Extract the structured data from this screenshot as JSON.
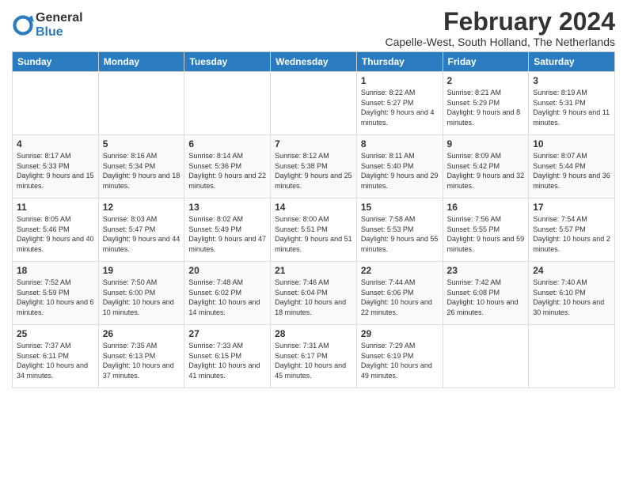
{
  "logo": {
    "general": "General",
    "blue": "Blue"
  },
  "header": {
    "title": "February 2024",
    "subtitle": "Capelle-West, South Holland, The Netherlands"
  },
  "weekdays": [
    "Sunday",
    "Monday",
    "Tuesday",
    "Wednesday",
    "Thursday",
    "Friday",
    "Saturday"
  ],
  "weeks": [
    [
      {
        "day": "",
        "info": ""
      },
      {
        "day": "",
        "info": ""
      },
      {
        "day": "",
        "info": ""
      },
      {
        "day": "",
        "info": ""
      },
      {
        "day": "1",
        "info": "Sunrise: 8:22 AM\nSunset: 5:27 PM\nDaylight: 9 hours\nand 4 minutes."
      },
      {
        "day": "2",
        "info": "Sunrise: 8:21 AM\nSunset: 5:29 PM\nDaylight: 9 hours\nand 8 minutes."
      },
      {
        "day": "3",
        "info": "Sunrise: 8:19 AM\nSunset: 5:31 PM\nDaylight: 9 hours\nand 11 minutes."
      }
    ],
    [
      {
        "day": "4",
        "info": "Sunrise: 8:17 AM\nSunset: 5:33 PM\nDaylight: 9 hours\nand 15 minutes."
      },
      {
        "day": "5",
        "info": "Sunrise: 8:16 AM\nSunset: 5:34 PM\nDaylight: 9 hours\nand 18 minutes."
      },
      {
        "day": "6",
        "info": "Sunrise: 8:14 AM\nSunset: 5:36 PM\nDaylight: 9 hours\nand 22 minutes."
      },
      {
        "day": "7",
        "info": "Sunrise: 8:12 AM\nSunset: 5:38 PM\nDaylight: 9 hours\nand 25 minutes."
      },
      {
        "day": "8",
        "info": "Sunrise: 8:11 AM\nSunset: 5:40 PM\nDaylight: 9 hours\nand 29 minutes."
      },
      {
        "day": "9",
        "info": "Sunrise: 8:09 AM\nSunset: 5:42 PM\nDaylight: 9 hours\nand 32 minutes."
      },
      {
        "day": "10",
        "info": "Sunrise: 8:07 AM\nSunset: 5:44 PM\nDaylight: 9 hours\nand 36 minutes."
      }
    ],
    [
      {
        "day": "11",
        "info": "Sunrise: 8:05 AM\nSunset: 5:46 PM\nDaylight: 9 hours\nand 40 minutes."
      },
      {
        "day": "12",
        "info": "Sunrise: 8:03 AM\nSunset: 5:47 PM\nDaylight: 9 hours\nand 44 minutes."
      },
      {
        "day": "13",
        "info": "Sunrise: 8:02 AM\nSunset: 5:49 PM\nDaylight: 9 hours\nand 47 minutes."
      },
      {
        "day": "14",
        "info": "Sunrise: 8:00 AM\nSunset: 5:51 PM\nDaylight: 9 hours\nand 51 minutes."
      },
      {
        "day": "15",
        "info": "Sunrise: 7:58 AM\nSunset: 5:53 PM\nDaylight: 9 hours\nand 55 minutes."
      },
      {
        "day": "16",
        "info": "Sunrise: 7:56 AM\nSunset: 5:55 PM\nDaylight: 9 hours\nand 59 minutes."
      },
      {
        "day": "17",
        "info": "Sunrise: 7:54 AM\nSunset: 5:57 PM\nDaylight: 10 hours\nand 2 minutes."
      }
    ],
    [
      {
        "day": "18",
        "info": "Sunrise: 7:52 AM\nSunset: 5:59 PM\nDaylight: 10 hours\nand 6 minutes."
      },
      {
        "day": "19",
        "info": "Sunrise: 7:50 AM\nSunset: 6:00 PM\nDaylight: 10 hours\nand 10 minutes."
      },
      {
        "day": "20",
        "info": "Sunrise: 7:48 AM\nSunset: 6:02 PM\nDaylight: 10 hours\nand 14 minutes."
      },
      {
        "day": "21",
        "info": "Sunrise: 7:46 AM\nSunset: 6:04 PM\nDaylight: 10 hours\nand 18 minutes."
      },
      {
        "day": "22",
        "info": "Sunrise: 7:44 AM\nSunset: 6:06 PM\nDaylight: 10 hours\nand 22 minutes."
      },
      {
        "day": "23",
        "info": "Sunrise: 7:42 AM\nSunset: 6:08 PM\nDaylight: 10 hours\nand 26 minutes."
      },
      {
        "day": "24",
        "info": "Sunrise: 7:40 AM\nSunset: 6:10 PM\nDaylight: 10 hours\nand 30 minutes."
      }
    ],
    [
      {
        "day": "25",
        "info": "Sunrise: 7:37 AM\nSunset: 6:11 PM\nDaylight: 10 hours\nand 34 minutes."
      },
      {
        "day": "26",
        "info": "Sunrise: 7:35 AM\nSunset: 6:13 PM\nDaylight: 10 hours\nand 37 minutes."
      },
      {
        "day": "27",
        "info": "Sunrise: 7:33 AM\nSunset: 6:15 PM\nDaylight: 10 hours\nand 41 minutes."
      },
      {
        "day": "28",
        "info": "Sunrise: 7:31 AM\nSunset: 6:17 PM\nDaylight: 10 hours\nand 45 minutes."
      },
      {
        "day": "29",
        "info": "Sunrise: 7:29 AM\nSunset: 6:19 PM\nDaylight: 10 hours\nand 49 minutes."
      },
      {
        "day": "",
        "info": ""
      },
      {
        "day": "",
        "info": ""
      }
    ]
  ]
}
